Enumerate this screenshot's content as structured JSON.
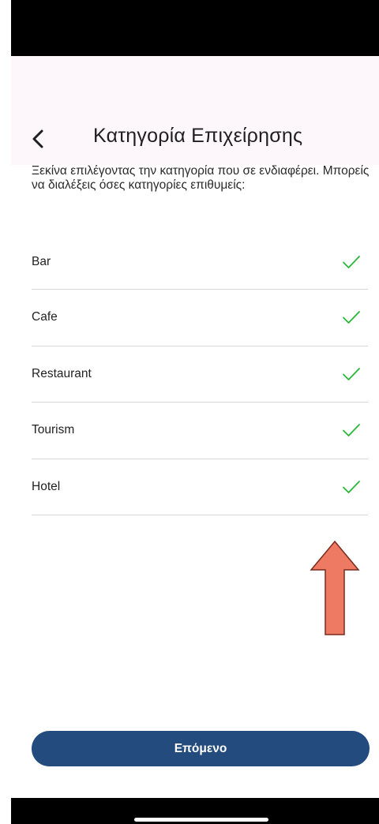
{
  "header": {
    "title": "Κατηγορία Επιχείρησης",
    "back_icon": "chevron-left-icon"
  },
  "intro_text": "Ξεκίνα επιλέγοντας την κατηγορία που σε ενδιαφέρει. Μπορείς να διαλέξεις όσες κατηγορίες επιθυμείς:",
  "categories": [
    {
      "label": "Bar",
      "selected": true
    },
    {
      "label": "Cafe",
      "selected": true
    },
    {
      "label": "Restaurant",
      "selected": true
    },
    {
      "label": "Tourism",
      "selected": true
    },
    {
      "label": "Hotel",
      "selected": true
    }
  ],
  "next_button": {
    "label": "Επόμενο"
  },
  "colors": {
    "header_bg": "#fdf6fb",
    "check": "#2db53a",
    "button_bg": "#234b7e",
    "annotation_arrow": "#ef7a63"
  }
}
